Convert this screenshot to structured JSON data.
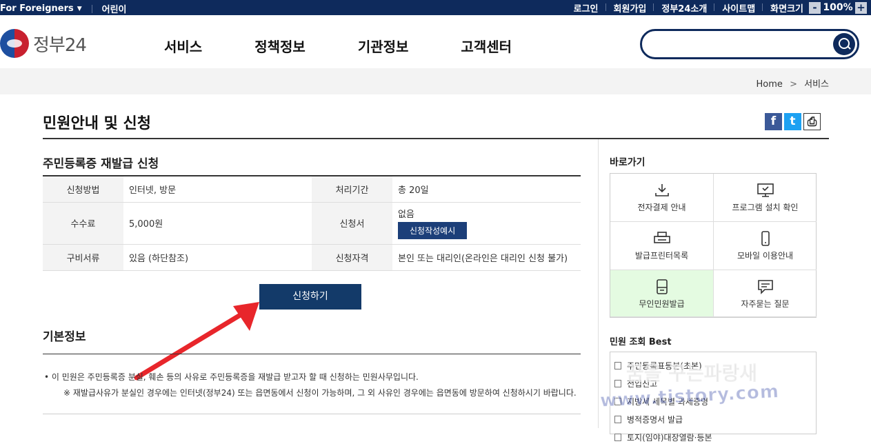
{
  "topbar": {
    "foreigners": "For Foreigners",
    "kids": "어린이",
    "links": [
      "로그인",
      "회원가입",
      "정부24소개",
      "사이트맵",
      "화면크기"
    ],
    "zoom_minus": "-",
    "zoom_value": "100%",
    "zoom_plus": "+"
  },
  "header": {
    "logo": "정부24",
    "nav": [
      "서비스",
      "정책정보",
      "기관정보",
      "고객센터"
    ],
    "search_placeholder": ""
  },
  "breadcrumb": {
    "home": "Home",
    "arrow": ">",
    "current": "서비스"
  },
  "page_title": "민원안내 및 신청",
  "share": {
    "facebook": "f",
    "twitter": "t",
    "print": "⎙"
  },
  "service": {
    "title": "주민등록증 재발급 신청",
    "rows": [
      {
        "h1": "신청방법",
        "v1": "인터넷, 방문",
        "h2": "처리기간",
        "v2": "총 20일"
      },
      {
        "h1": "수수료",
        "v1": "5,000원",
        "h2": "신청서",
        "v2": "없음",
        "form_btn": "신청작성예시"
      },
      {
        "h1": "구비서류",
        "v1": "있음 (하단참조)",
        "h2": "신청자격",
        "v2": "본인 또는 대리인(온라인은 대리인 신청 불가)"
      }
    ],
    "apply_button": "신청하기"
  },
  "basic": {
    "title": "기본정보",
    "desc1": "• 이 민원은 주민등록증 분실, 훼손 등의 사유로 주민등록증을 재발급 받고자 할 때 신청하는 민원사무입니다.",
    "desc2": "※ 재발급사유가 분실인 경우에는 인터넷(정부24) 또는 읍면동에서 신청이 가능하며, 그 외 사유인 경우에는 읍면동에 방문하여 신청하시기 바랍니다."
  },
  "sidebar": {
    "quick_title": "바로가기",
    "quick": [
      {
        "label": "전자결제 안내",
        "icon": "download-icon"
      },
      {
        "label": "프로그램 설치 확인",
        "icon": "monitor-icon"
      },
      {
        "label": "발급프린터목록",
        "icon": "printer-icon"
      },
      {
        "label": "모바일 이용안내",
        "icon": "mobile-icon"
      },
      {
        "label": "무인민원발급",
        "icon": "kiosk-icon"
      },
      {
        "label": "자주묻는 질문",
        "icon": "chat-icon"
      }
    ],
    "best_title": "민원 조회 Best",
    "best": [
      "주민등록표등본(초본)",
      "전입신고",
      "지방세 세목별 과세증명",
      "병적증명서 발급",
      "토지(임야)대장열람·등본"
    ]
  },
  "watermark": {
    "line1": "꿈을 꾸는파랑새",
    "line2": "www.tistory.com"
  },
  "colors": {
    "navy": "#0e2a5c",
    "button": "#133a69",
    "highlight": "#e4fbe1",
    "arrow": "#e8262b"
  }
}
